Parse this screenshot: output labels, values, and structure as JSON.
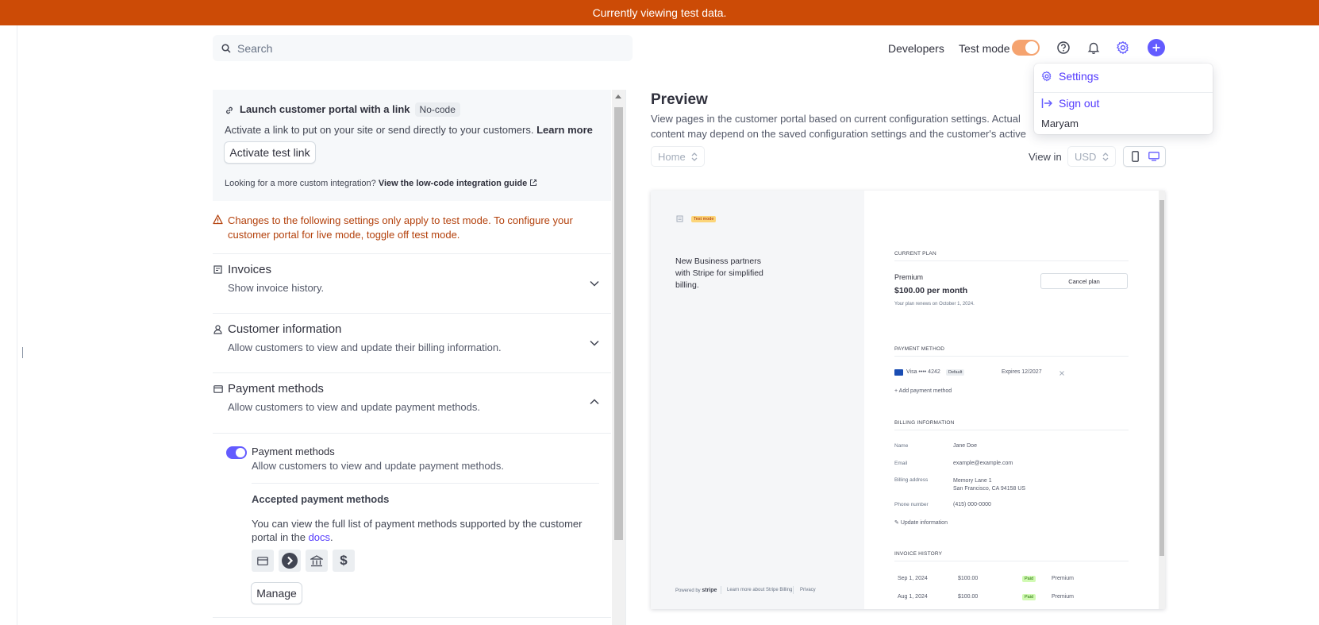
{
  "banner": {
    "text": "Currently viewing test data."
  },
  "search": {
    "placeholder": "Search"
  },
  "topnav": {
    "developers": "Developers",
    "test_mode": "Test mode"
  },
  "menu": {
    "settings": "Settings",
    "sign_out": "Sign out",
    "user": "Maryam"
  },
  "launch": {
    "title": "Launch customer portal with a link",
    "badge": "No-code",
    "desc": "Activate a link to put on your site or send directly to your customers.",
    "learn_more": "Learn more",
    "button": "Activate test link",
    "custom_q": "Looking for a more custom integration?",
    "custom_link": "View the low-code integration guide"
  },
  "warning": {
    "line1": "Changes to the following settings only apply to test mode. To configure your",
    "line2": "customer portal for live mode, toggle off test mode."
  },
  "sections": [
    {
      "title": "Invoices",
      "sub": "Show invoice history."
    },
    {
      "title": "Customer information",
      "sub": "Allow customers to view and update their billing information."
    },
    {
      "title": "Payment methods",
      "sub": "Allow customers to view and update payment methods."
    }
  ],
  "payment": {
    "toggle_title": "Payment methods",
    "toggle_sub": "Allow customers to view and update payment methods.",
    "accepted_title": "Accepted payment methods",
    "accepted_desc1": "You can view the full list of payment methods supported by the customer",
    "accepted_desc2": "portal in the",
    "docs": "docs",
    "period": ".",
    "manage": "Manage"
  },
  "preview": {
    "title": "Preview",
    "desc": "View pages in the customer portal based on current configuration settings. Actual content may depend on the saved configuration settings and the customer's active subscriptions.",
    "page_select": "Home",
    "view_in": "View in",
    "currency": "USD"
  },
  "portal": {
    "test_badge": "Test mode",
    "tagline1": "New Business partners",
    "tagline2": "with Stripe for simplified",
    "tagline3": "billing.",
    "powered_by": "Powered by",
    "stripe": "stripe",
    "learn_billing": "Learn more about Stripe Billing",
    "privacy": "Privacy",
    "current_plan": "CURRENT PLAN",
    "plan_name": "Premium",
    "plan_price": "$100.00 per month",
    "renews": "Your plan renews on October 1, 2024.",
    "cancel": "Cancel plan",
    "payment_method": "PAYMENT METHOD",
    "card": "Visa •••• 4242",
    "default": "Default",
    "expires": "Expires 12/2027",
    "add_pm": "Add payment method",
    "billing_info": "BILLING INFORMATION",
    "fields": [
      {
        "label": "Name",
        "value": "Jane Doe"
      },
      {
        "label": "Email",
        "value": "example@example.com"
      },
      {
        "label": "Billing address",
        "value": "Memory Lane 1",
        "value2": "San Francisco, CA 94158 US"
      },
      {
        "label": "Phone number",
        "value": "(415) 000-0000"
      }
    ],
    "update_info": "Update information",
    "invoice_history": "INVOICE HISTORY",
    "invoices": [
      {
        "date": "Sep 1, 2024",
        "amount": "$100.00",
        "status": "Paid",
        "plan": "Premium"
      },
      {
        "date": "Aug 1, 2024",
        "amount": "$100.00",
        "status": "Paid",
        "plan": "Premium"
      }
    ]
  }
}
